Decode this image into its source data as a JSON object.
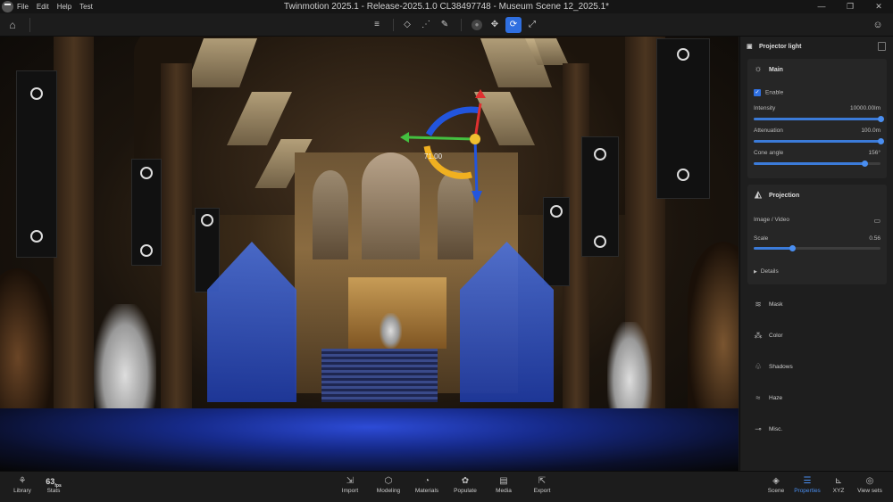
{
  "app": {
    "title": "Twinmotion 2025.1 - Release-2025.1.0 CL38497748 - Museum Scene 12_2025.1*",
    "menu": [
      "File",
      "Edit",
      "Help",
      "Test"
    ],
    "window_controls": [
      "—",
      "❐",
      "✕"
    ]
  },
  "toolbar": {
    "tools": [
      {
        "name": "align-icon",
        "glyph": "≡"
      },
      {
        "name": "shapes-icon",
        "glyph": "◇"
      },
      {
        "name": "paint-icon",
        "glyph": "⋰"
      },
      {
        "name": "eyedropper-icon",
        "glyph": "✎"
      },
      {
        "name": "snap-icon",
        "glyph": "●"
      },
      {
        "name": "move-icon",
        "glyph": "✥"
      },
      {
        "name": "rotate-icon",
        "glyph": "⟳"
      },
      {
        "name": "scale-icon",
        "glyph": "⤢"
      }
    ],
    "selected_tool": "rotate-icon"
  },
  "viewport": {
    "gizmo_value": "71.00"
  },
  "panel": {
    "title": "Projector light",
    "main": {
      "title": "Main",
      "enable_label": "Enable",
      "enabled": true,
      "intensity": {
        "label": "Intensity",
        "value": "10000.00lm",
        "fraction": 1.0
      },
      "attenuation": {
        "label": "Attenuation",
        "value": "100.0m",
        "fraction": 1.0
      },
      "cone_angle": {
        "label": "Cone angle",
        "value": "156°",
        "fraction": 0.87
      }
    },
    "projection": {
      "title": "Projection",
      "image_label": "Image / Video",
      "scale": {
        "label": "Scale",
        "value": "0.56",
        "fraction": 0.3
      },
      "details_label": "Details"
    },
    "sections": [
      "Mask",
      "Color",
      "Shadows",
      "Haze",
      "Misc."
    ]
  },
  "bottom": {
    "left": [
      {
        "label": "Library",
        "icon": "library-icon"
      },
      {
        "label": "Stats",
        "value": "63",
        "unit": "fps"
      }
    ],
    "center": [
      {
        "label": "Import",
        "icon": "import-icon",
        "glyph": "⇲"
      },
      {
        "label": "Modeling",
        "icon": "cube-icon",
        "glyph": "⬡"
      },
      {
        "label": "Materials",
        "icon": "materials-icon",
        "glyph": "◔"
      },
      {
        "label": "Populate",
        "icon": "populate-icon",
        "glyph": "✿"
      },
      {
        "label": "Media",
        "icon": "media-icon",
        "glyph": "▤"
      },
      {
        "label": "Export",
        "icon": "export-icon",
        "glyph": "⇱"
      }
    ],
    "right": [
      {
        "label": "Scene",
        "icon": "scene-icon",
        "glyph": "◈"
      },
      {
        "label": "Properties",
        "icon": "properties-icon",
        "glyph": "☰",
        "active": true
      },
      {
        "label": "XYZ",
        "icon": "xyz-icon",
        "glyph": "⊾"
      },
      {
        "label": "View sets",
        "icon": "viewsets-icon",
        "glyph": "◎"
      }
    ]
  },
  "colors": {
    "accent": "#2f6fe0",
    "panel_bg": "#1e1e1e",
    "card_bg": "#262626"
  }
}
